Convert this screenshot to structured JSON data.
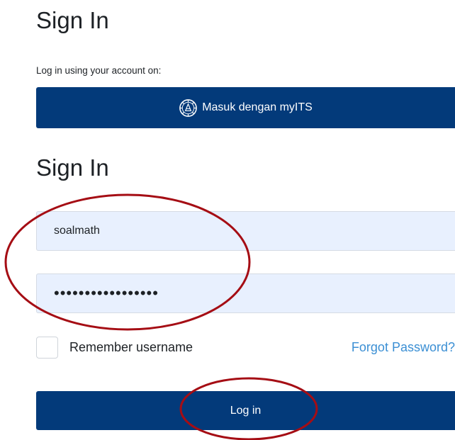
{
  "heading_top": "Sign In",
  "subtitle": "Log in using your account on:",
  "sso_button": {
    "label": "Masuk dengan myITS"
  },
  "heading_form": "Sign In",
  "username": {
    "value": "soalmath"
  },
  "password": {
    "value": "•••••••••••••••••"
  },
  "remember": {
    "label": "Remember username",
    "checked": false
  },
  "forgot_password": "Forgot Password?",
  "login_button": {
    "label": "Log in"
  },
  "colors": {
    "primary": "#033a7a",
    "link": "#3b8fd4",
    "field_bg": "#e8f0fe",
    "annotation": "#a50d14"
  }
}
